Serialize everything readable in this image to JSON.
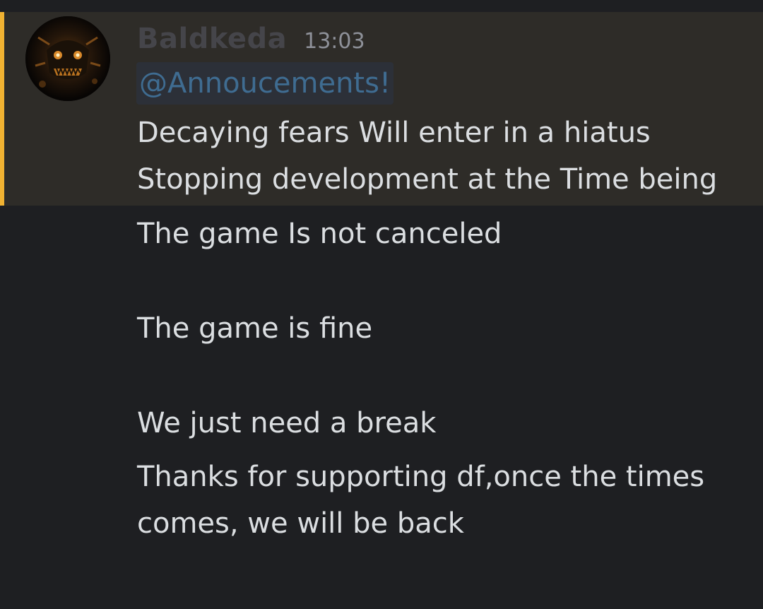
{
  "message": {
    "author": "Baldkeda",
    "timestamp": "13:03",
    "mention": "@Annoucements!",
    "lines": [
      "Decaying fears Will enter in a hiatus",
      "Stopping development at the Time being",
      "The game Is not canceled",
      "The game is fine",
      "We just need a break",
      "Thanks for supporting df,once the times",
      "comes, we will be back"
    ]
  },
  "colors": {
    "background": "#1e1f22",
    "highlight_background": "#2e2c28",
    "highlight_bar": "#f0b232",
    "mention_text": "#3f6c91",
    "message_text": "#dbdee1"
  }
}
